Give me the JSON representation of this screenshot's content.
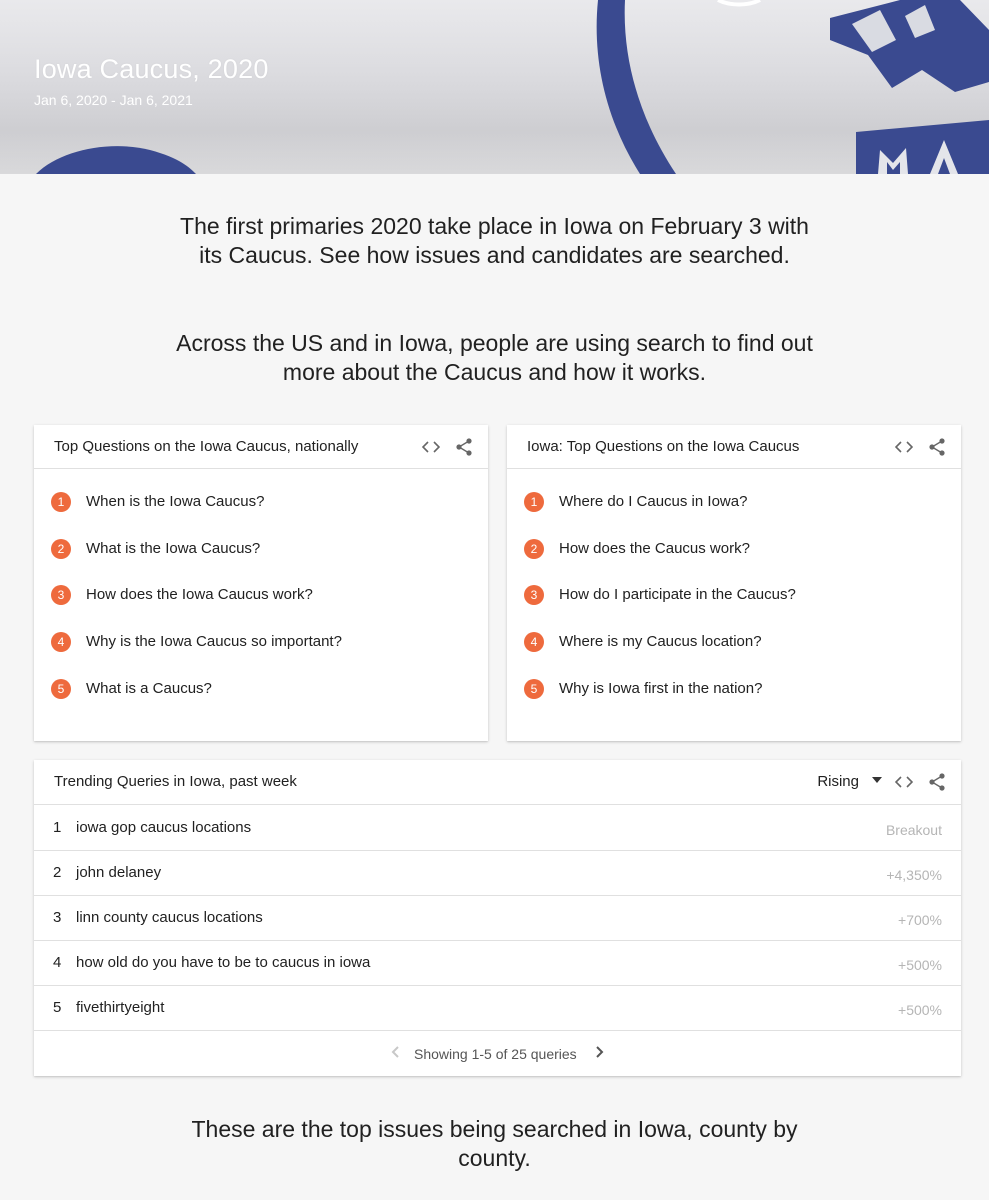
{
  "hero": {
    "title": "Iowa Caucus, 2020",
    "date_range": "Jan 6, 2020 - Jan 6, 2021"
  },
  "intro": {
    "paragraph1": [
      "The first primaries 2020 take place in Iowa on February 3 with",
      "its Caucus. See how issues and candidates are searched."
    ],
    "paragraph2": [
      "Across the US and in Iowa, people are using search to find out",
      "more about the Caucus and how it works."
    ],
    "paragraph3": [
      "These are the top issues being searched in Iowa, county by",
      "county."
    ]
  },
  "national_card": {
    "title": "Top Questions on the Iowa Caucus, nationally",
    "embed_icon": "code-brackets-icon",
    "share_icon": "share-icon",
    "questions": [
      {
        "rank": "1",
        "text": "When is the Iowa Caucus?"
      },
      {
        "rank": "2",
        "text": "What is the Iowa Caucus?"
      },
      {
        "rank": "3",
        "text": "How does the Iowa Caucus work?"
      },
      {
        "rank": "4",
        "text": "Why is the Iowa Caucus so important?"
      },
      {
        "rank": "5",
        "text": "What is a Caucus?"
      }
    ]
  },
  "iowa_card": {
    "title": "Iowa: Top Questions on the Iowa Caucus",
    "embed_icon": "code-brackets-icon",
    "share_icon": "share-icon",
    "questions": [
      {
        "rank": "1",
        "text": "Where do I Caucus in Iowa?"
      },
      {
        "rank": "2",
        "text": "How does the Caucus work?"
      },
      {
        "rank": "3",
        "text": "How do I participate in the Caucus?"
      },
      {
        "rank": "4",
        "text": "Where is my Caucus location?"
      },
      {
        "rank": "5",
        "text": "Why is Iowa first in the nation?"
      }
    ]
  },
  "trending_card": {
    "title": "Trending Queries in Iowa, past week",
    "filter_selected": "Rising",
    "rows": [
      {
        "rank": "1",
        "query": "iowa gop caucus locations",
        "value": "Breakout"
      },
      {
        "rank": "2",
        "query": "john delaney",
        "value": "+4,350%"
      },
      {
        "rank": "3",
        "query": "linn county caucus locations",
        "value": "+700%"
      },
      {
        "rank": "4",
        "query": "how old do you have to be to caucus in iowa",
        "value": "+500%"
      },
      {
        "rank": "5",
        "query": "fivethirtyeight",
        "value": "+500%"
      }
    ],
    "pagination": "Showing 1-5 of 25 queries"
  },
  "colors": {
    "rank_badge": "#ee6a3d",
    "hero_shape": "#3a4a90",
    "page_background": "#f6f6f6"
  }
}
